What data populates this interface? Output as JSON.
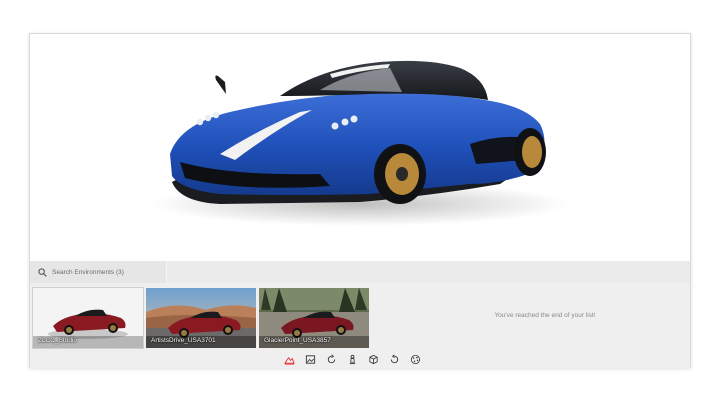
{
  "search": {
    "placeholder": "Search Environments (3)"
  },
  "environments": [
    {
      "label": "ZLCC_Studio",
      "selected": true
    },
    {
      "label": "ArtistsDrive_USA3701",
      "selected": false
    },
    {
      "label": "GlacierPoint_USA3857",
      "selected": false
    }
  ],
  "end_message": "You've reached the end of your list!",
  "toolbar": {
    "items": [
      {
        "icon": "environment-icon",
        "active": true
      },
      {
        "icon": "image-icon",
        "active": false
      },
      {
        "icon": "rotate-icon",
        "active": false
      },
      {
        "icon": "chess-pawn-icon",
        "active": false
      },
      {
        "icon": "cube-icon",
        "active": false
      },
      {
        "icon": "refresh-icon",
        "active": false
      },
      {
        "icon": "palette-icon",
        "active": false
      }
    ]
  },
  "colors": {
    "car_body": "#1f4fb8",
    "accent": "#e0343b",
    "wheel": "#b8893a"
  }
}
